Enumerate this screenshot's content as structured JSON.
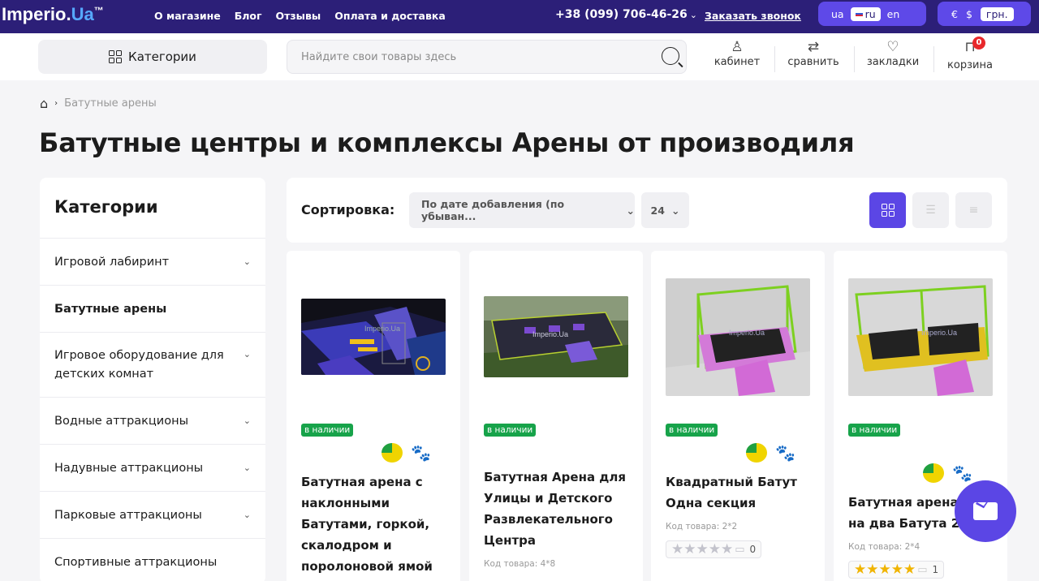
{
  "topbar": {
    "logo_main": "Imperio.",
    "logo_ua": "Ua",
    "logo_tm": "™",
    "nav": [
      "О магазине",
      "Блог",
      "Отзывы",
      "Оплата и доставка"
    ],
    "phone": "+38 (099) 706-46-26",
    "callback": "Заказать звонок",
    "languages": [
      "ua",
      "ru",
      "en"
    ],
    "active_language": "ru",
    "currencies": [
      "€",
      "$",
      "грн."
    ],
    "active_currency": "грн."
  },
  "header": {
    "categories_button": "Категории",
    "search_placeholder": "Найдите свои товары здесь",
    "actions": [
      {
        "label": "кабинет",
        "icon": "user-icon"
      },
      {
        "label": "сравнить",
        "icon": "compare-icon"
      },
      {
        "label": "закладки",
        "icon": "heart-icon"
      },
      {
        "label": "корзина",
        "icon": "bag-icon"
      }
    ],
    "cart_count": "0"
  },
  "breadcrumb": {
    "current": "Батутные арены"
  },
  "page_title": "Батутные центры и комплексы Арены от производиля",
  "sidebar": {
    "title": "Категории",
    "items": [
      {
        "label": "Игровой лабиринт"
      },
      {
        "label": "Батутные арены"
      },
      {
        "label": "Игровое оборудование для детских комнат"
      },
      {
        "label": "Водные аттракционы"
      },
      {
        "label": "Надувные аттракционы"
      },
      {
        "label": "Парковые аттракционы"
      },
      {
        "label": "Спортивные аттракционы"
      }
    ]
  },
  "toolbar": {
    "sort_label": "Сортировка:",
    "sort_value": "По дате добавления (по убыван...",
    "per_page": "24"
  },
  "products": [
    {
      "stock": "в наличии",
      "title_lines": [
        "Батутная арена с",
        "наклонными",
        "Батутами, горкой,",
        "скалодром и",
        "поролоновой ямой"
      ]
    },
    {
      "stock": "в наличии",
      "title_lines": [
        "Батутная Арена для",
        "Улицы и Детского",
        "Развлекательного",
        "Центра"
      ],
      "code": "Код товара: 4*8"
    },
    {
      "stock": "в наличии",
      "title_lines": [
        "Квадратный Батут",
        "Одна секция"
      ],
      "code": "Код товара: 2*2",
      "rating_count": "0"
    },
    {
      "stock": "в наличии",
      "title_lines": [
        "Батутная арена 2",
        "на два Батута 2*2"
      ],
      "code": "Код товара: 2*4",
      "rating_count": "1"
    }
  ],
  "watermark": "Imperio.Ua",
  "colors": {
    "topbar": "#2c1f78",
    "accent": "#5b46e5",
    "stock": "#17a34a",
    "badge": "#e8282b"
  }
}
